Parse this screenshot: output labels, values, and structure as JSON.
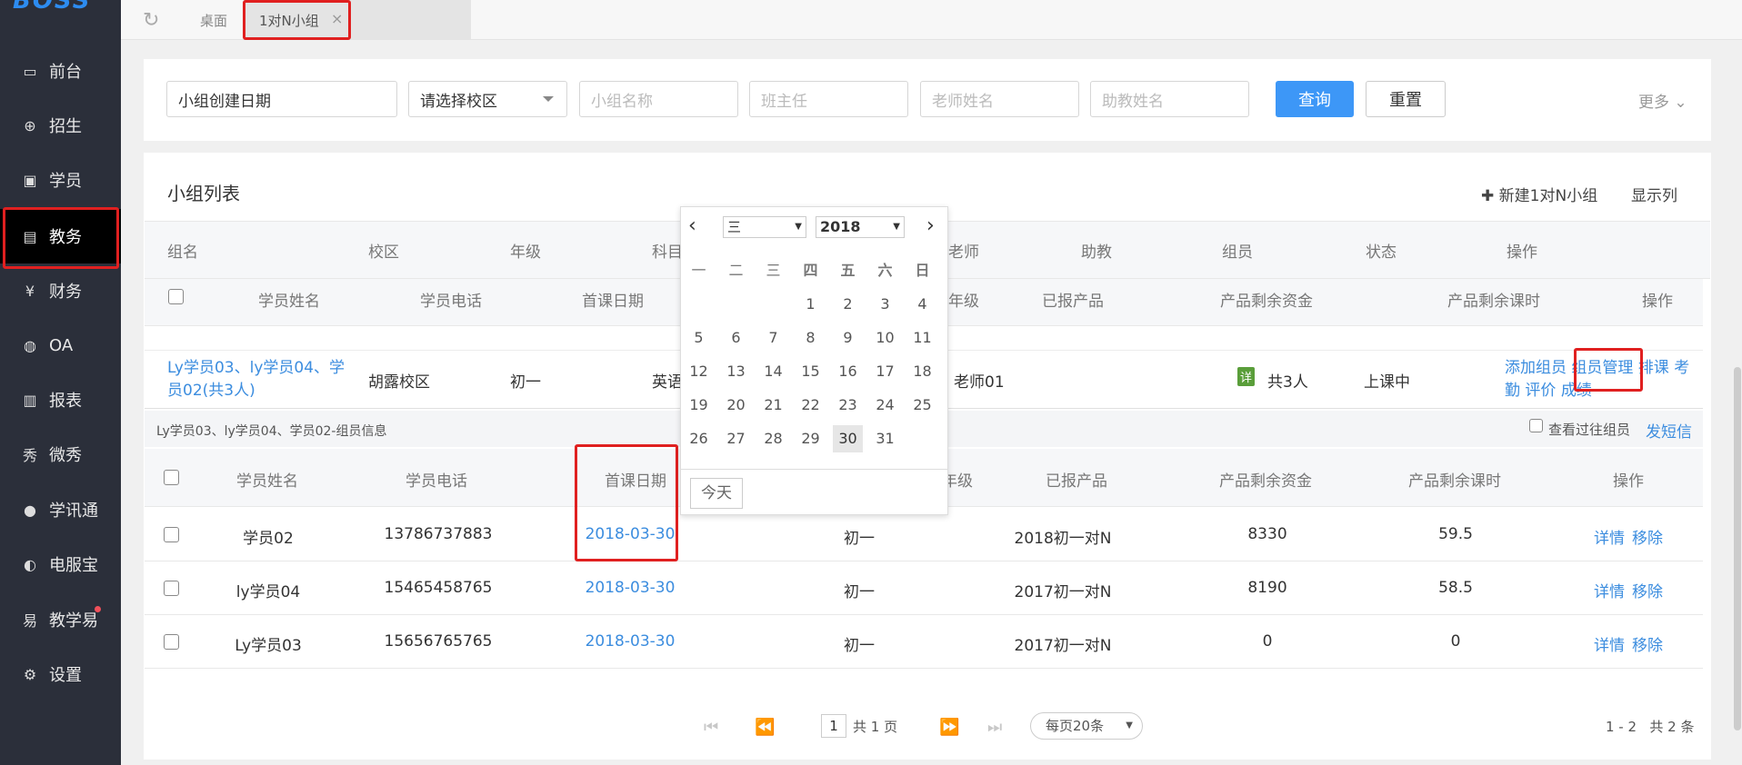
{
  "app": {
    "logo": "BOSS"
  },
  "sidebar": {
    "items": [
      {
        "label": "前台",
        "icon": "calendar-icon"
      },
      {
        "label": "招生",
        "icon": "user-add-icon"
      },
      {
        "label": "学员",
        "icon": "student-card-icon"
      },
      {
        "label": "教务",
        "icon": "book-icon"
      },
      {
        "label": "财务",
        "icon": "yen-icon"
      },
      {
        "label": "OA",
        "icon": "oa-icon"
      },
      {
        "label": "报表",
        "icon": "bar-chart-icon"
      },
      {
        "label": "微秀",
        "icon": "show-icon"
      },
      {
        "label": "学讯通",
        "icon": "location-icon"
      },
      {
        "label": "电服宝",
        "icon": "phone-service-icon"
      },
      {
        "label": "教学易",
        "icon": "teach-icon"
      },
      {
        "label": "设置",
        "icon": "gear-icon"
      }
    ]
  },
  "tabs": [
    {
      "label": "桌面"
    },
    {
      "label": "1对N小组",
      "close": "×"
    }
  ],
  "filters": {
    "date_value": "小组创建日期",
    "campus_value": "请选择校区",
    "group_name_placeholder": "小组名称",
    "head_teacher_placeholder": "班主任",
    "teacher_placeholder": "老师姓名",
    "assistant_placeholder": "助教姓名",
    "search_label": "查询",
    "reset_label": "重置",
    "more_label": "更多"
  },
  "group_list": {
    "title": "小组列表",
    "new_label": "新建1对N小组",
    "columns_label": "显示列",
    "headers": [
      "组名",
      "校区",
      "年级",
      "科目",
      "老师",
      "助教",
      "组员",
      "状态",
      "操作"
    ],
    "sub_headers": [
      "学员姓名",
      "学员电话",
      "首课日期",
      "年级",
      "已报产品",
      "产品剩余资金",
      "产品剩余课时",
      "操作"
    ],
    "row": {
      "name_line1": "Ly学员03、ly学员04、学",
      "name_line2": "员02(共3人)",
      "campus": "胡露校区",
      "grade": "初一",
      "subject": "英语",
      "teacher": "老师01",
      "detail_badge": "详",
      "members": "共3人",
      "status": "上课中",
      "actions_line1": [
        "添加组员",
        "组员管理",
        "排课",
        "考"
      ],
      "actions_line2": [
        "勤",
        "评价",
        "成绩"
      ]
    }
  },
  "members_panel": {
    "title": "Ly学员03、ly学员04、学员02-组员信息",
    "history_label": "查看过往组员",
    "sms_label": "发短信",
    "headers": [
      "学员姓名",
      "学员电话",
      "首课日期",
      "年级",
      "已报产品",
      "产品剩余资金",
      "产品剩余课时",
      "操作"
    ],
    "rows": [
      {
        "name": "学员02",
        "phone": "13786737883",
        "date": "2018-03-30",
        "grade": "初一",
        "product": "2018初一对N",
        "funds": "8330",
        "hours": "59.5",
        "detail": "详情",
        "remove": "移除"
      },
      {
        "name": "ly学员04",
        "phone": "15465458765",
        "date": "2018-03-30",
        "grade": "初一",
        "product": "2017初一对N",
        "funds": "8190",
        "hours": "58.5",
        "detail": "详情",
        "remove": "移除"
      },
      {
        "name": "Ly学员03",
        "phone": "15656765765",
        "date": "2018-03-30",
        "grade": "初一",
        "product": "2017初一对N",
        "funds": "0",
        "hours": "0",
        "detail": "详情",
        "remove": "移除"
      }
    ]
  },
  "calendar": {
    "month": "三",
    "year": "2018",
    "weekdays": [
      "一",
      "二",
      "三",
      "四",
      "五",
      "六",
      "日"
    ],
    "days": [
      "1",
      "2",
      "3",
      "4",
      "5",
      "6",
      "7",
      "8",
      "9",
      "10",
      "11",
      "12",
      "13",
      "14",
      "15",
      "16",
      "17",
      "18",
      "19",
      "20",
      "21",
      "22",
      "23",
      "24",
      "25",
      "26",
      "27",
      "28",
      "29",
      "30",
      "31"
    ],
    "selected": "30",
    "today_label": "今天"
  },
  "pager": {
    "page": "1",
    "total_pages": "共 1 页",
    "page_size": "每页20条",
    "range": "1 - 2",
    "total": "共 2 条"
  },
  "colors": {
    "accent": "#3d97f7",
    "link": "#3c8ddf",
    "highlight": "#e02020",
    "sidebar": "#2b2f3a"
  }
}
